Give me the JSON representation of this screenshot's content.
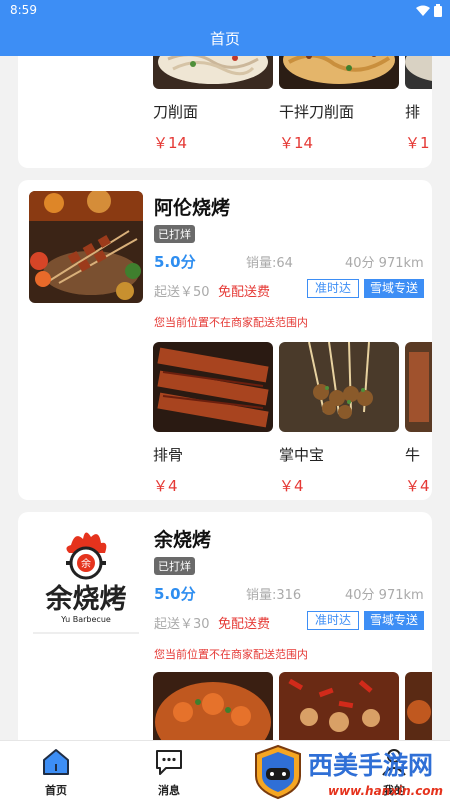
{
  "status": {
    "time": "8:59"
  },
  "header": {
    "title": "首页"
  },
  "shops": [
    {
      "dishes": [
        {
          "name": "刀削面",
          "price": "￥14"
        },
        {
          "name": "干拌刀削面",
          "price": "￥14"
        },
        {
          "name": "排",
          "price": "￥1"
        }
      ]
    },
    {
      "name": "阿伦烧烤",
      "tag": "已打烊",
      "rating": "5.0分",
      "sales": "销量:64",
      "distance": "40分 971km",
      "min_order": "起送￥50",
      "delivery_fee": "免配送费",
      "badge_ontime": "准时达",
      "badge_delivery": "雪域专送",
      "notice": "您当前位置不在商家配送范围内",
      "dishes": [
        {
          "name": "排骨",
          "price": "￥4"
        },
        {
          "name": "掌中宝",
          "price": "￥4"
        },
        {
          "name": "牛",
          "price": "￥4"
        }
      ]
    },
    {
      "name": "余烧烤",
      "logo_text": "余烧烤",
      "logo_sub": "Yu Barbecue",
      "logo_badge": "余",
      "tag": "已打烊",
      "rating": "5.0分",
      "sales": "销量:316",
      "distance": "40分 971km",
      "min_order": "起送￥30",
      "delivery_fee": "免配送费",
      "badge_ontime": "准时达",
      "badge_delivery": "雪域专送",
      "notice": "您当前位置不在商家配送范围内"
    }
  ],
  "tabbar": {
    "home": "首页",
    "messages": "消息",
    "mine": "我的"
  },
  "watermark": {
    "text": "西美手游网",
    "url": "www.hanxin.com"
  },
  "colors": {
    "primary": "#3d8ef5",
    "price": "#e53935"
  }
}
